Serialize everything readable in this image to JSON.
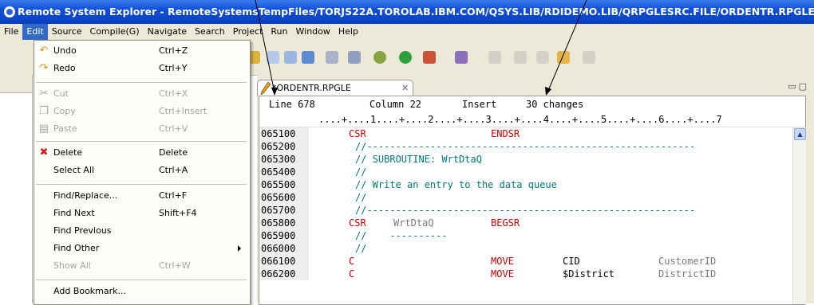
{
  "window": {
    "title": "Remote System Explorer - RemoteSystemsTempFiles/TORJS22A.TOROLAB.IBM.COM/QSYS.LIB/RDIDEMO.LIB/QRPGLESRC.FILE/ORDENTR.RPGLE - IBM"
  },
  "menubar": {
    "items": [
      "File",
      "Edit",
      "Source",
      "Compile(G)",
      "Navigate",
      "Search",
      "Project",
      "Run",
      "Window",
      "Help"
    ],
    "active_index": 1
  },
  "edit_menu": {
    "items": [
      {
        "label": "Undo",
        "shortcut": "Ctrl+Z",
        "icon": "undo-icon",
        "enabled": true
      },
      {
        "label": "Redo",
        "shortcut": "Ctrl+Y",
        "icon": "redo-icon",
        "enabled": true
      },
      {
        "label": "Cut",
        "shortcut": "Ctrl+X",
        "icon": "cut-icon",
        "enabled": false
      },
      {
        "label": "Copy",
        "shortcut": "Ctrl+Insert",
        "icon": "copy-icon",
        "enabled": false
      },
      {
        "label": "Paste",
        "shortcut": "Ctrl+V",
        "icon": "paste-icon",
        "enabled": false
      },
      {
        "label": "Delete",
        "shortcut": "Delete",
        "icon": "delete-icon",
        "enabled": true
      },
      {
        "label": "Select All",
        "shortcut": "Ctrl+A",
        "icon": "",
        "enabled": true
      },
      {
        "label": "Find/Replace...",
        "shortcut": "Ctrl+F",
        "icon": "",
        "enabled": true
      },
      {
        "label": "Find Next",
        "shortcut": "Shift+F4",
        "icon": "",
        "enabled": true
      },
      {
        "label": "Find Previous",
        "shortcut": "",
        "icon": "",
        "enabled": true
      },
      {
        "label": "Find Other",
        "shortcut": "",
        "icon": "",
        "enabled": true
      },
      {
        "label": "Show All",
        "shortcut": "Ctrl+W",
        "icon": "",
        "enabled": false
      },
      {
        "label": "Add Bookmark...",
        "shortcut": "",
        "icon": "",
        "enabled": true
      }
    ]
  },
  "editor": {
    "tab_label": "*ORDENTR.RPGLE",
    "tab_close": "✕",
    "status_line": "Line 678",
    "status_column": "Column 22",
    "status_mode": "Insert",
    "status_changes": "30 changes",
    "ruler": "....+....1....+....2....+....3....+....4....+....5....+....6....+....7",
    "lines": [
      {
        "num": "065100",
        "a": "CSR",
        "b": "",
        "c": "ENDSR",
        "d": "",
        "e": ""
      },
      {
        "num": "065200",
        "comment": "//---------------------------------------------------------"
      },
      {
        "num": "065300",
        "comment": "// SUBROUTINE: WrtDtaQ"
      },
      {
        "num": "065400",
        "comment": "//"
      },
      {
        "num": "065500",
        "comment": "// Write an entry to the data queue"
      },
      {
        "num": "065600",
        "comment": "//"
      },
      {
        "num": "065700",
        "comment": "//---------------------------------------------------------"
      },
      {
        "num": "065800",
        "a": "CSR",
        "b": "WrtDtaQ",
        "c": "BEGSR",
        "d": "",
        "e": ""
      },
      {
        "num": "065900",
        "comment": "//    ----------"
      },
      {
        "num": "066000",
        "comment": "//"
      },
      {
        "num": "066100",
        "a": "C",
        "b": "",
        "c": "MOVE",
        "d": "CID",
        "e": "CustomerID"
      },
      {
        "num": "066200",
        "a": "C",
        "b": "",
        "c": "MOVE",
        "d": "$District",
        "e": "DistrictID"
      }
    ]
  },
  "colors": {
    "title_bar": "#0f4fd6",
    "menu_bg": "#ece9d8",
    "menu_highlight": "#316ac5",
    "keyword_red": "#cc0000",
    "comment_teal": "#007a7a"
  }
}
